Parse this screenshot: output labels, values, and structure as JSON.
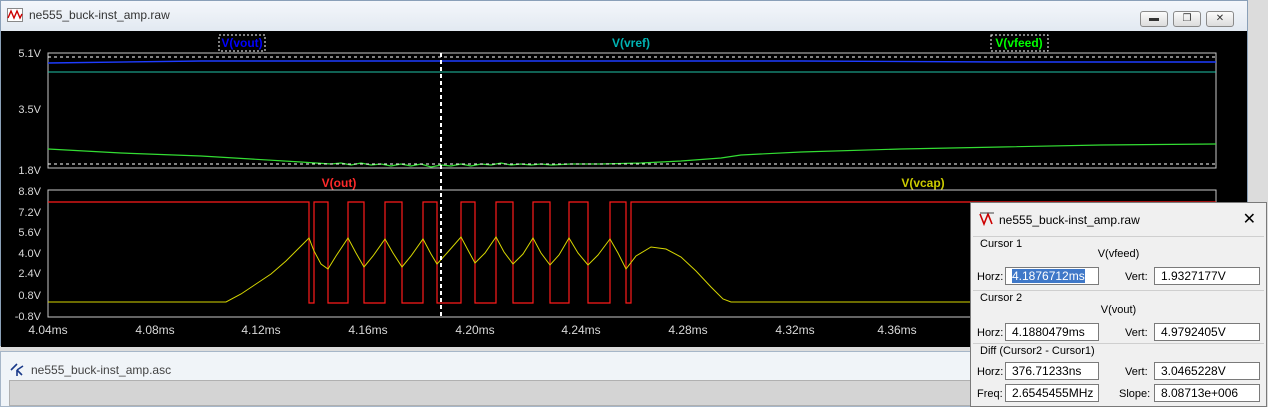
{
  "main_window": {
    "title": "ne555_buck-inst_amp.raw",
    "buttons": {
      "minimize": "▬",
      "restore": "❐",
      "close": "✕"
    }
  },
  "top_pane": {
    "y_ticks": [
      "5.1V",
      "3.5V",
      "1.8V"
    ],
    "traces": [
      {
        "label": "V(vout)",
        "color": "#0000ff"
      },
      {
        "label": "V(vref)",
        "color": "#00b3b3"
      },
      {
        "label": "V(vfeed)",
        "color": "#00ff00"
      }
    ]
  },
  "bottom_pane": {
    "y_ticks": [
      "8.8V",
      "7.2V",
      "5.6V",
      "4.0V",
      "2.4V",
      "0.8V",
      "-0.8V"
    ],
    "traces": [
      {
        "label": "V(out)",
        "color": "#ff0000"
      },
      {
        "label": "V(vcap)",
        "color": "#cccc00"
      }
    ]
  },
  "x_ticks": [
    "4.04ms",
    "4.08ms",
    "4.12ms",
    "4.16ms",
    "4.20ms",
    "4.24ms",
    "4.28ms",
    "4.32ms",
    "4.36ms"
  ],
  "second_window": {
    "title": "ne555_buck-inst_amp.asc"
  },
  "cursor_dialog": {
    "title": "ne555_buck-inst_amp.raw",
    "close": "✕",
    "cursor1": {
      "group": "Cursor 1",
      "trace": "V(vfeed)",
      "horz_label": "Horz:",
      "horz": "4.1876712ms",
      "vert_label": "Vert:",
      "vert": "1.9327177V"
    },
    "cursor2": {
      "group": "Cursor 2",
      "trace": "V(vout)",
      "horz_label": "Horz:",
      "horz": "4.1880479ms",
      "vert_label": "Vert:",
      "vert": "4.9792405V"
    },
    "diff": {
      "group": "Diff (Cursor2 - Cursor1)",
      "horz_label": "Horz:",
      "horz": "376.71233ns",
      "vert_label": "Vert:",
      "vert": "3.0465228V",
      "freq_label": "Freq:",
      "freq": "2.6545455MHz",
      "slope_label": "Slope:",
      "slope": "8.08713e+006"
    }
  }
}
